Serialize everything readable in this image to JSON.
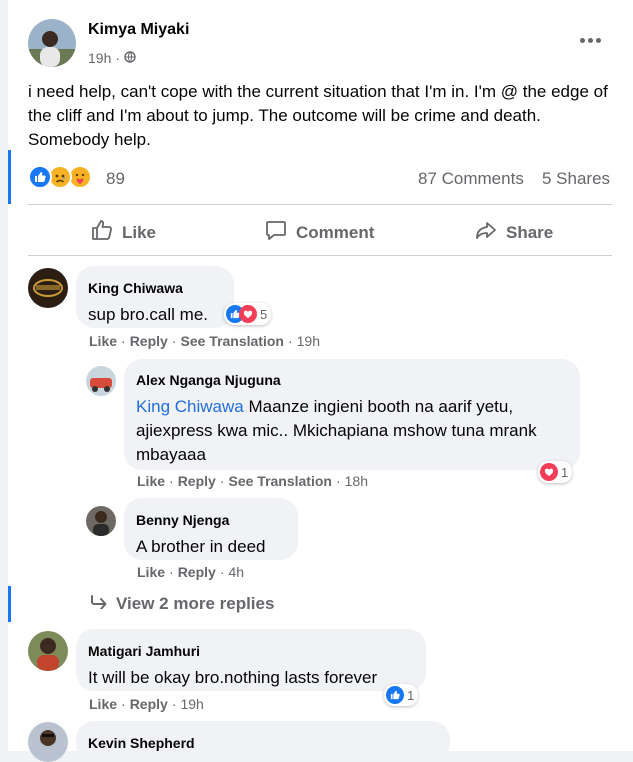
{
  "post": {
    "author": "Kimya Miyaki",
    "time": "19h",
    "privacy_icon": "globe-icon",
    "text": "i need help, can't cope with the current situation that I'm in. I'm @ the edge of the cliff and I'm about to jump. The outcome will be crime and death. Somebody help.",
    "reactions_count": "89",
    "reaction_icons": [
      "like-icon",
      "sad-icon",
      "care-icon"
    ],
    "comments_count": "87 Comments",
    "shares_count": "5 Shares"
  },
  "actions": {
    "like": "Like",
    "comment": "Comment",
    "share": "Share"
  },
  "comments": [
    {
      "author": "King Chiwawa",
      "text": "sup bro.call me.",
      "reaction_count": "5",
      "reaction_icons": [
        "like-icon",
        "love-icon"
      ],
      "like": "Like",
      "reply": "Reply",
      "translate": "See Translation",
      "time": "19h",
      "replies": [
        {
          "author": "Alex Nganga Njuguna",
          "mention": "King Chiwawa",
          "text": " Maanze ingieni booth na aarif yetu, ajiexpress kwa mic.. Mkichapiana mshow tuna mrank mbayaaa",
          "reaction_count": "1",
          "reaction_icons": [
            "love-icon"
          ],
          "like": "Like",
          "reply": "Reply",
          "translate": "See Translation",
          "time": "18h"
        },
        {
          "author": "Benny Njenga",
          "text": "A brother in deed",
          "like": "Like",
          "reply": "Reply",
          "time": "4h"
        }
      ],
      "more_replies": "View 2 more replies"
    },
    {
      "author": "Matigari Jamhuri",
      "text": "It will be okay bro.nothing lasts forever",
      "reaction_count": "1",
      "reaction_icons": [
        "like-icon"
      ],
      "like": "Like",
      "reply": "Reply",
      "time": "19h"
    },
    {
      "author": "Kevin Shepherd"
    }
  ],
  "separator": "·",
  "colors": {
    "like_blue": "#1877f2",
    "love_red": "#f33e58",
    "sad_yellow": "#f7b125",
    "link": "#216fdb"
  }
}
